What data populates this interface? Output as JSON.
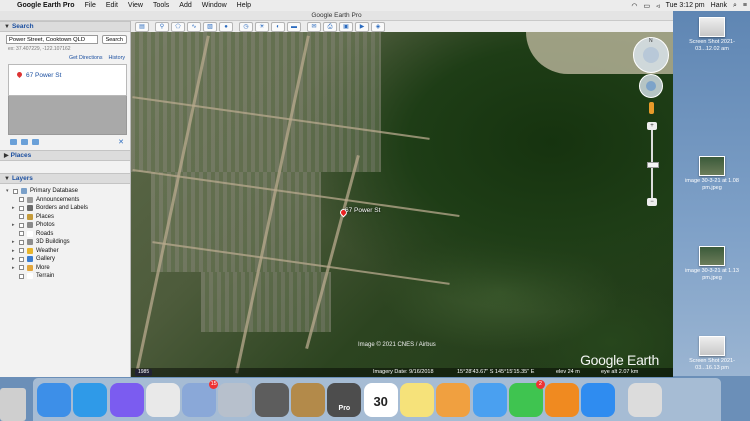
{
  "menubar": {
    "app_name": "Google Earth Pro",
    "menus": [
      "File",
      "Edit",
      "View",
      "Tools",
      "Add",
      "Window",
      "Help"
    ],
    "clock": "Tue 3:12 pm",
    "user": "Hank"
  },
  "window": {
    "title": "Google Earth Pro"
  },
  "search": {
    "header": "Search",
    "query": "Power Street, Cooktown QLD",
    "button": "Search",
    "hint": "ex: 37.407229, -122.107162",
    "links": [
      "Get Directions",
      "History"
    ],
    "result": "67 Power St"
  },
  "places": {
    "header": "Places"
  },
  "layers": {
    "header": "Layers",
    "items": [
      {
        "label": "Primary Database",
        "expander": "▾",
        "icon_color": "#7aa0c9"
      },
      {
        "label": "Announcements",
        "expander": "",
        "icon_color": "#9b9b9b"
      },
      {
        "label": "Borders and Labels",
        "expander": "▸",
        "icon_color": "#6a6a6a"
      },
      {
        "label": "Places",
        "expander": "",
        "icon_color": "#c59b3a"
      },
      {
        "label": "Photos",
        "expander": "▸",
        "icon_color": "#8a8a8a"
      },
      {
        "label": "Roads",
        "expander": "",
        "icon_color": "#ffffff"
      },
      {
        "label": "3D Buildings",
        "expander": "▸",
        "icon_color": "#8c8c8c"
      },
      {
        "label": "Weather",
        "expander": "▸",
        "icon_color": "#e7b52c"
      },
      {
        "label": "Gallery",
        "expander": "▸",
        "icon_color": "#3a7cd0"
      },
      {
        "label": "More",
        "expander": "▸",
        "icon_color": "#e2a63c"
      },
      {
        "label": "Terrain",
        "expander": "",
        "icon_color": "#ffffff"
      }
    ]
  },
  "map": {
    "placemark": "67 Power St",
    "credit": "Image © 2021 CNES / Airbus",
    "logo": "Google Earth",
    "year": "1985",
    "imagery_date": "Imagery Date: 9/16/2018",
    "coords": "15°28'43.67\" S   145°15'15.35\" E",
    "elev": "elev    24 m",
    "eye_alt": "eye alt   2.07 km",
    "compass_n": "N"
  },
  "desktop_files": [
    {
      "label": "Screen Shot 2021-03...12.02 am",
      "style": "light"
    },
    {
      "label": "image 30-3-21 at 1.08 pm.jpeg",
      "style": "dark"
    },
    {
      "label": "image 30-3-21 at 1.13 pm.jpeg",
      "style": "dark"
    },
    {
      "label": "Screen Shot 2021-03...16.13 pm",
      "style": "light"
    }
  ],
  "dock": {
    "apps": [
      {
        "name": "finder-icon",
        "color": "#3d8fe8",
        "text": "",
        "badge": ""
      },
      {
        "name": "safari-icon",
        "color": "#2f9ae8",
        "text": "",
        "badge": ""
      },
      {
        "name": "messenger-icon",
        "color": "#7b5cf0",
        "text": "",
        "badge": ""
      },
      {
        "name": "chrome-icon",
        "color": "#e9e9e9",
        "text": "",
        "badge": ""
      },
      {
        "name": "mail-stamp-icon",
        "color": "#8aa8d8",
        "text": "",
        "badge": "15"
      },
      {
        "name": "launchpad-icon",
        "color": "#b7c0cc",
        "text": "",
        "badge": ""
      },
      {
        "name": "screenshot-icon",
        "color": "#5d5d5d",
        "text": "",
        "badge": ""
      },
      {
        "name": "notes-box-icon",
        "color": "#b38a4a",
        "text": "",
        "badge": ""
      },
      {
        "name": "google-earth-pro-icon",
        "color": "#4d4d4d",
        "text": "Pro",
        "badge": ""
      },
      {
        "name": "calendar-icon",
        "color": "#ffffff",
        "text": "30",
        "badge": ""
      },
      {
        "name": "notepad-icon",
        "color": "#f6e27a",
        "text": "",
        "badge": ""
      },
      {
        "name": "photos-icon",
        "color": "#f0a040",
        "text": "",
        "badge": ""
      },
      {
        "name": "messages-icon",
        "color": "#4aa0f0",
        "text": "",
        "badge": ""
      },
      {
        "name": "facetime-icon",
        "color": "#3fc450",
        "text": "",
        "badge": "2"
      },
      {
        "name": "books-icon",
        "color": "#f08a20",
        "text": "",
        "badge": ""
      },
      {
        "name": "app-store-icon",
        "color": "#2f8cf0",
        "text": "",
        "badge": ""
      },
      {
        "name": "spacer",
        "color": "transparent",
        "text": "",
        "badge": ""
      },
      {
        "name": "trash-icon",
        "color": "#dcdcdc",
        "text": "",
        "badge": ""
      }
    ]
  }
}
